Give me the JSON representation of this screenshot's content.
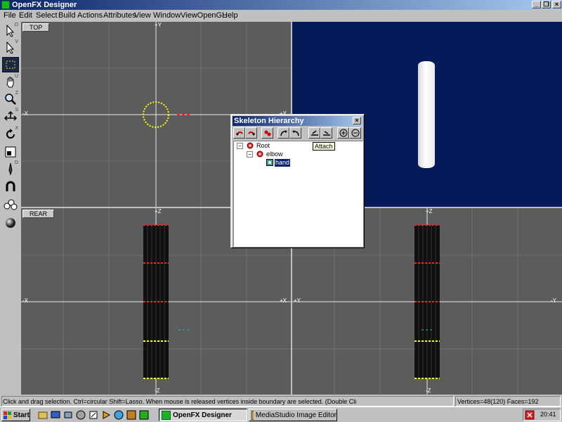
{
  "window": {
    "title": "OpenFX Designer"
  },
  "menu": [
    "File",
    "Edit",
    "Select",
    "Build",
    "Actions",
    "Attributes",
    "View",
    "Window",
    "ViewOpenGL",
    "Help"
  ],
  "tools": [
    {
      "icon": "pointer-arrow-icon",
      "key": "O"
    },
    {
      "icon": "vertex-pointer-icon",
      "key": "V"
    },
    {
      "icon": "select-box-icon",
      "key": ""
    },
    {
      "icon": "hand-pan-icon",
      "key": "U"
    },
    {
      "icon": "zoom-magnifier-icon",
      "key": "Z"
    },
    {
      "icon": "scale-arrows-icon",
      "key": "S"
    },
    {
      "icon": "rotate-icon",
      "key": "X"
    },
    {
      "icon": "frame-view-icon",
      "key": ""
    },
    {
      "icon": "pen-tool-icon",
      "key": "D"
    },
    {
      "icon": "magnet-icon",
      "key": ""
    },
    {
      "icon": "group-circles-icon",
      "key": ""
    },
    {
      "icon": "sphere-render-icon",
      "key": ""
    }
  ],
  "viewports": {
    "top": {
      "label": "TOP",
      "axis_pos": "+Y",
      "axis_left": "-X",
      "axis_right": "+X"
    },
    "rear": {
      "label": "REAR",
      "axis_top": "+Z",
      "axis_bottom": "-Z",
      "axis_left": "-X",
      "axis_right": "+X"
    },
    "side": {
      "axis_top": "+Z",
      "axis_bottom": "-Z",
      "axis_left": "+Y",
      "axis_right": "-Y"
    }
  },
  "skeleton_dialog": {
    "title": "Skeleton Hierarchy",
    "close": "×",
    "tooltip": "Attach",
    "tree": [
      {
        "label": "Root",
        "level": 0,
        "expander": "−"
      },
      {
        "label": "elbow",
        "level": 1,
        "expander": "−"
      },
      {
        "label": "hand",
        "level": 2,
        "selected": true
      }
    ]
  },
  "status": {
    "message": "Click and drag selection. Ctrl=circular Shift=Lasso. When mouse is released  vertices inside boundary are selected. (Double Cli",
    "counts": "Vertices=48(120) Faces=192"
  },
  "taskbar": {
    "start": "Start",
    "tasks": [
      {
        "label": "OpenFX Designer",
        "active": true
      },
      {
        "label": "MediaStudio Image Editor",
        "active": false
      }
    ],
    "clock": "20:41"
  },
  "colors": {
    "viewport_bg": "#5c5c5c",
    "perspective_bg": "#051a59",
    "titlebar": "#0a246a",
    "selection_yellow": "#ffff00",
    "selection_red": "#ff2020"
  }
}
